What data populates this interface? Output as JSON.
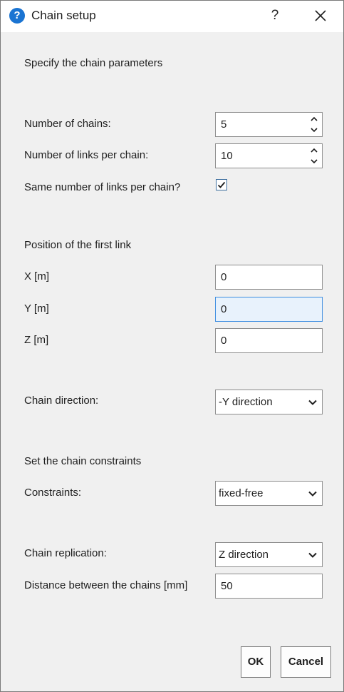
{
  "window": {
    "title": "Chain setup",
    "help_label": "?"
  },
  "sections": {
    "chain_parameters_heading": "Specify the chain parameters",
    "first_link_heading": "Position of the first link",
    "constraints_heading": "Set the chain constraints"
  },
  "fields": {
    "number_of_chains": {
      "label": "Number of chains:",
      "value": "5"
    },
    "links_per_chain": {
      "label": "Number of links per chain:",
      "value": "10"
    },
    "same_links": {
      "label": "Same number of links per chain?",
      "checked": true
    },
    "x": {
      "label": "X [m]",
      "value": "0"
    },
    "y": {
      "label": "Y [m]",
      "value": "0"
    },
    "z": {
      "label": "Z [m]",
      "value": "0"
    },
    "chain_direction": {
      "label": "Chain direction:",
      "value": "-Y direction"
    },
    "constraints": {
      "label": "Constraints:",
      "value": "fixed-free"
    },
    "chain_replication": {
      "label": "Chain replication:",
      "value": "Z direction"
    },
    "distance_between_chains": {
      "label": "Distance between the chains [mm]",
      "value": "50"
    }
  },
  "buttons": {
    "ok": "OK",
    "cancel": "Cancel"
  },
  "colors": {
    "accent": "#1a74d2",
    "focus_border": "#3c8ce0",
    "focus_fill": "#e8f2fc",
    "window_bg": "#f0f0f0",
    "titlebar_bg": "#ffffff"
  },
  "icons": {
    "title": "question-circle-icon",
    "close": "close-icon",
    "spin_up": "chevron-up-icon",
    "spin_down": "chevron-down-icon",
    "dropdown": "chevron-down-icon",
    "checkbox": "checkmark-icon"
  }
}
